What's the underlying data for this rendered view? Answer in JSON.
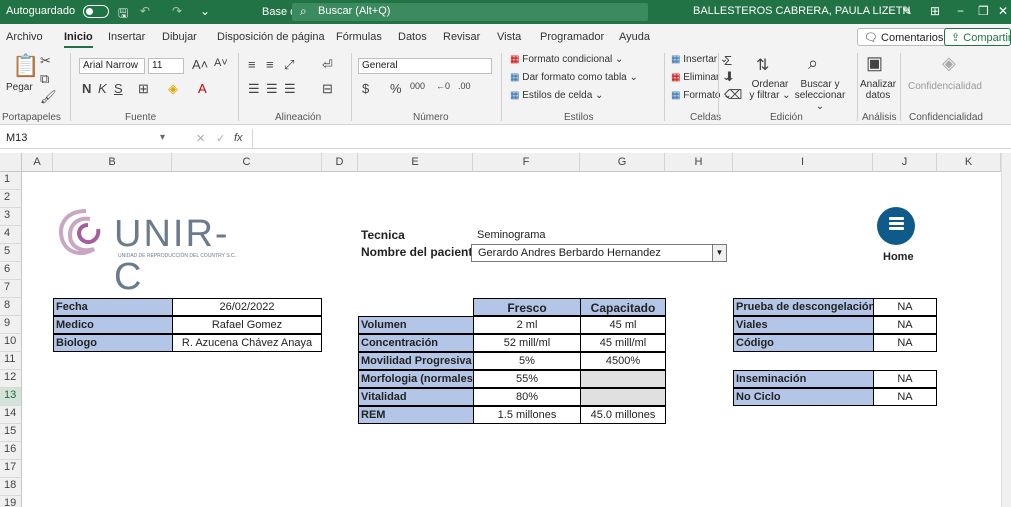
{
  "titlebar": {
    "autosave_label": "Autoguardado",
    "doc_title": "Base de datos prototipo ⌄",
    "search_placeholder": "Buscar (Alt+Q)",
    "user_name": "BALLESTEROS CABRERA, PAULA LIZETH"
  },
  "tabs": [
    "Archivo",
    "Inicio",
    "Insertar",
    "Dibujar",
    "Disposición de página",
    "Fórmulas",
    "Datos",
    "Revisar",
    "Vista",
    "Programador",
    "Ayuda"
  ],
  "tabs_right": {
    "comments": "Comentarios",
    "share": "Compartir"
  },
  "ribbon": {
    "paste": "Pegar",
    "font_name": "Arial Narrow",
    "font_size": "11",
    "number_format": "General",
    "cond_format": "Formato condicional ⌄",
    "table_format": "Dar formato como tabla ⌄",
    "cell_styles": "Estilos de celda ⌄",
    "insert": "Insertar ⌄",
    "delete": "Eliminar ⌄",
    "format": "Formato ⌄",
    "sort_filter": "Ordenar y filtrar ⌄",
    "find_select": "Buscar y seleccionar ⌄",
    "analyze": "Analizar datos",
    "confidentiality": "Confidencialidad",
    "groups": [
      "Portapapeles",
      "Fuente",
      "Alineación",
      "Número",
      "Estilos",
      "Celdas",
      "Edición",
      "Análisis",
      "Confidencialidad"
    ]
  },
  "formula_bar": {
    "name_box": "M13",
    "fx": "fx",
    "content": ""
  },
  "columns": [
    "A",
    "B",
    "C",
    "D",
    "E",
    "F",
    "G",
    "H",
    "I",
    "J",
    "K"
  ],
  "rows": [
    "1",
    "2",
    "3",
    "4",
    "5",
    "6",
    "7",
    "8",
    "9",
    "10",
    "11",
    "12",
    "13",
    "14",
    "15",
    "16",
    "17",
    "18",
    "19"
  ],
  "logo": {
    "brand": "UNIR-C",
    "tagline": "UNIDAD DE REPRODUCCIÓN DEL COUNTRY S.C."
  },
  "patient": {
    "tecnica_label": "Tecnica",
    "tecnica_value": "Seminograma",
    "name_label": "Nombre del paciente",
    "name_value": "Gerardo Andres Berbardo Hernandez"
  },
  "info_table": [
    {
      "label": "Fecha",
      "value": "26/02/2022"
    },
    {
      "label": "Medico",
      "value": "Rafael Gomez"
    },
    {
      "label": "Biologo",
      "value": "R. Azucena Chávez Anaya"
    }
  ],
  "results": {
    "col_fresco": "Fresco",
    "col_capacitado": "Capacitado",
    "rows": [
      {
        "label": "Volumen",
        "fresco": "2 ml",
        "capacitado": "45 ml"
      },
      {
        "label": "Concentración",
        "fresco": "52 mill/ml",
        "capacitado": "45 mill/ml"
      },
      {
        "label": "Movilidad Progresiva",
        "fresco": "5%",
        "capacitado": "4500%"
      },
      {
        "label": "Morfologia (normales)",
        "fresco": "55%",
        "capacitado": ""
      },
      {
        "label": "Vitalidad",
        "fresco": "80%",
        "capacitado": ""
      },
      {
        "label": "REM",
        "fresco": "1.5 millones",
        "capacitado": "45.0 millones"
      }
    ]
  },
  "side_table": [
    {
      "label": "Prueba de descongelación",
      "value": "NA"
    },
    {
      "label": "Viales",
      "value": "NA"
    },
    {
      "label": "Código",
      "value": "NA"
    }
  ],
  "side_table2": [
    {
      "label": "Inseminación",
      "value": "NA"
    },
    {
      "label": "No Ciclo",
      "value": "NA"
    }
  ],
  "home": {
    "label": "Home"
  },
  "colors": {
    "excel_green": "#217346",
    "label_blue": "#b4c6e7",
    "home_blue": "#0e5a8a"
  }
}
